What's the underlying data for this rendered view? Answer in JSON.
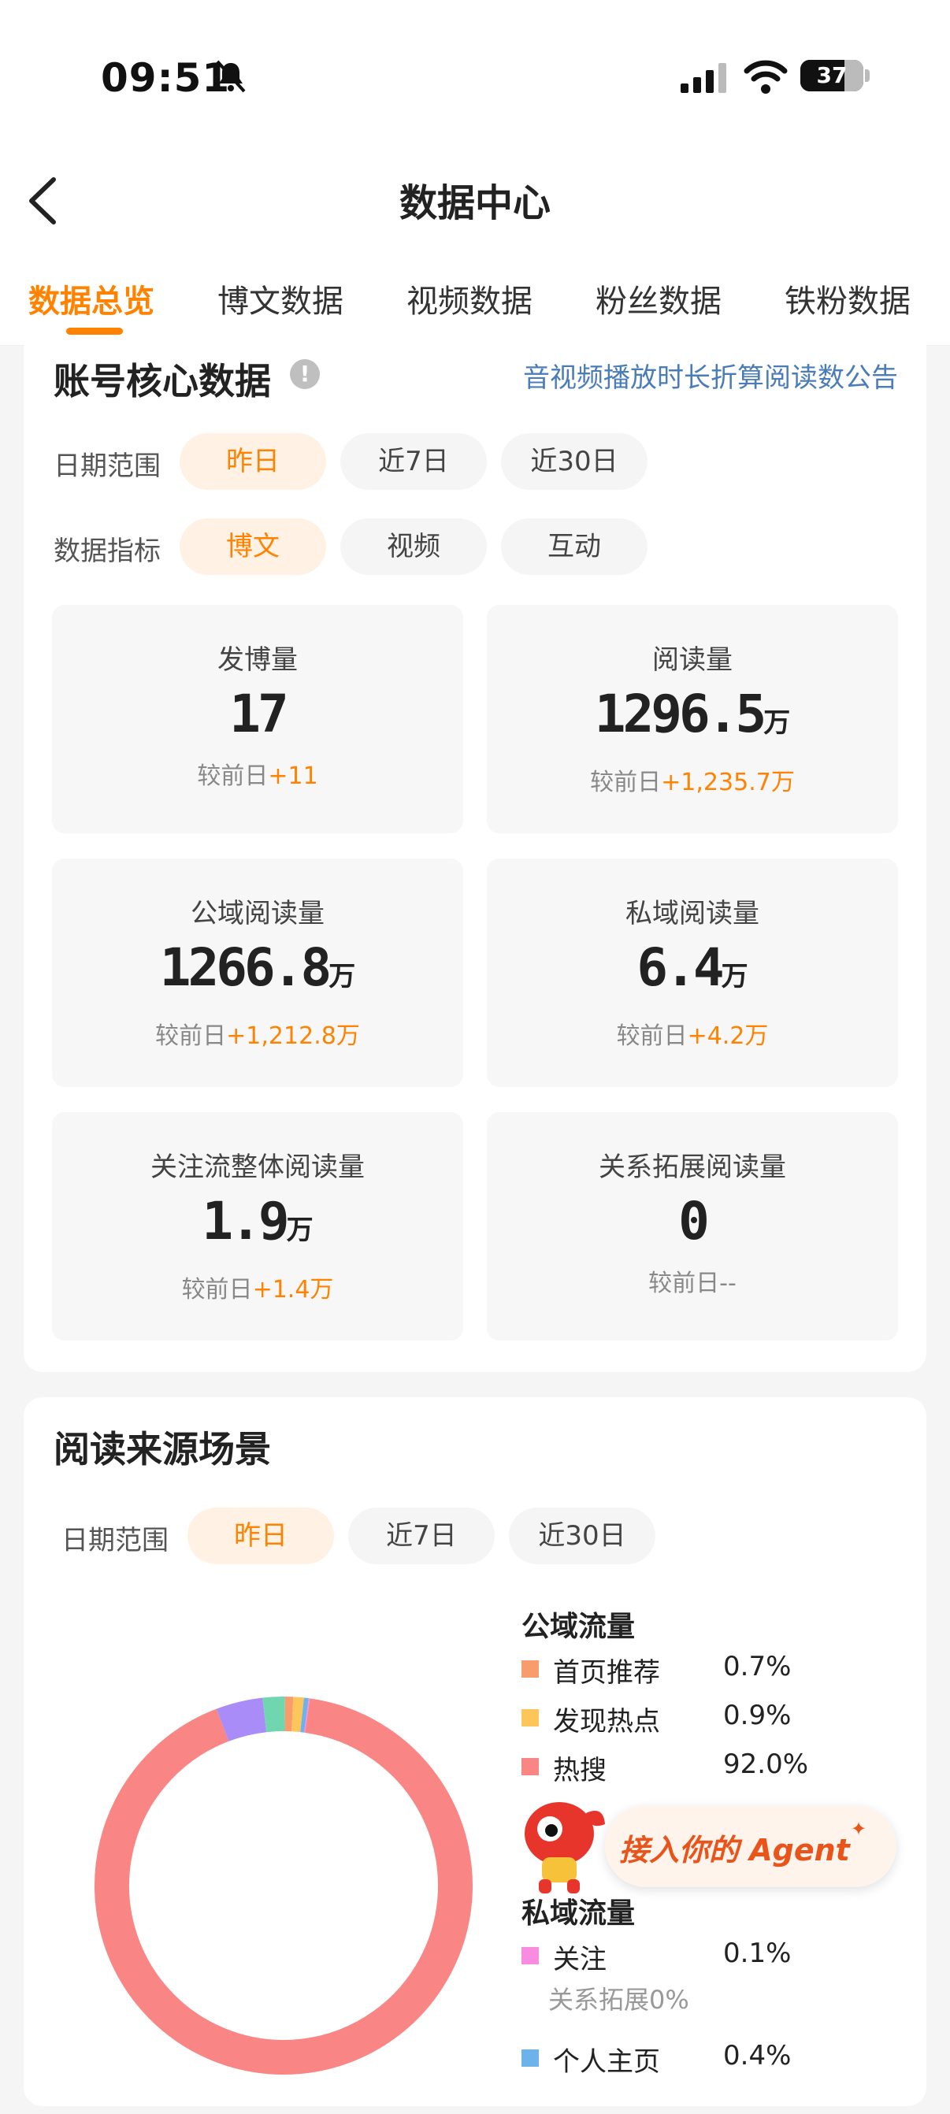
{
  "status_bar": {
    "time": "09:51",
    "battery": "37"
  },
  "header": {
    "title": "数据中心"
  },
  "tabs": [
    "数据总览",
    "博文数据",
    "视频数据",
    "粉丝数据",
    "铁粉数据"
  ],
  "core": {
    "title": "账号核心数据",
    "info": "!",
    "notice_link": "音视频播放时长折算阅读数公告",
    "date_label": "日期范围",
    "date_options": [
      "昨日",
      "近7日",
      "近30日"
    ],
    "metric_label": "数据指标",
    "metric_options": [
      "博文",
      "视频",
      "互动"
    ],
    "stats": [
      {
        "label": "发博量",
        "value": "17",
        "unit": "",
        "compare": "较前日",
        "delta": "+11"
      },
      {
        "label": "阅读量",
        "value": "1296.5",
        "unit": "万",
        "compare": "较前日",
        "delta": "+1,235.7万"
      },
      {
        "label": "公域阅读量",
        "value": "1266.8",
        "unit": "万",
        "compare": "较前日",
        "delta": "+1,212.8万"
      },
      {
        "label": "私域阅读量",
        "value": "6.4",
        "unit": "万",
        "compare": "较前日",
        "delta": "+4.2万"
      },
      {
        "label": "关注流整体阅读量",
        "value": "1.9",
        "unit": "万",
        "compare": "较前日",
        "delta": "+1.4万"
      },
      {
        "label": "关系拓展阅读量",
        "value": "0",
        "unit": "",
        "compare": "较前日",
        "delta": "--"
      }
    ]
  },
  "source": {
    "title": "阅读来源场景",
    "date_label": "日期范围",
    "date_options": [
      "昨日",
      "近7日",
      "近30日"
    ],
    "public_title": "公域流量",
    "private_title": "私域流量",
    "public_items": [
      {
        "label": "首页推荐",
        "pct": "0.7%",
        "color": "#f89c6b"
      },
      {
        "label": "发现热点",
        "pct": "0.9%",
        "color": "#fcc65a"
      },
      {
        "label": "热搜",
        "pct": "92.0%",
        "color": "#f98585"
      }
    ],
    "private_items": [
      {
        "label": "关注",
        "pct": "0.1%",
        "color": "#f98be0"
      },
      {
        "label": "个人主页",
        "pct": "0.4%",
        "color": "#6eb2ec"
      }
    ],
    "relation_sub": "关系拓展0%"
  },
  "agent_button": "接入你的 Agent",
  "chart_data": {
    "type": "pie",
    "title": "",
    "legend_position": "right",
    "slices": [
      {
        "label": "热搜",
        "value": 92.0,
        "color": "#f98585"
      },
      {
        "label": "",
        "value": 4.0,
        "color": "#a98cf7"
      },
      {
        "label": "",
        "value": 1.9,
        "color": "#6fd6b0"
      },
      {
        "label": "首页推荐",
        "value": 0.7,
        "color": "#f89c6b"
      },
      {
        "label": "发现热点",
        "value": 0.9,
        "color": "#fcc65a"
      },
      {
        "label": "个人主页",
        "value": 0.4,
        "color": "#6eb2ec"
      },
      {
        "label": "关注",
        "value": 0.1,
        "color": "#f98be0"
      }
    ]
  }
}
